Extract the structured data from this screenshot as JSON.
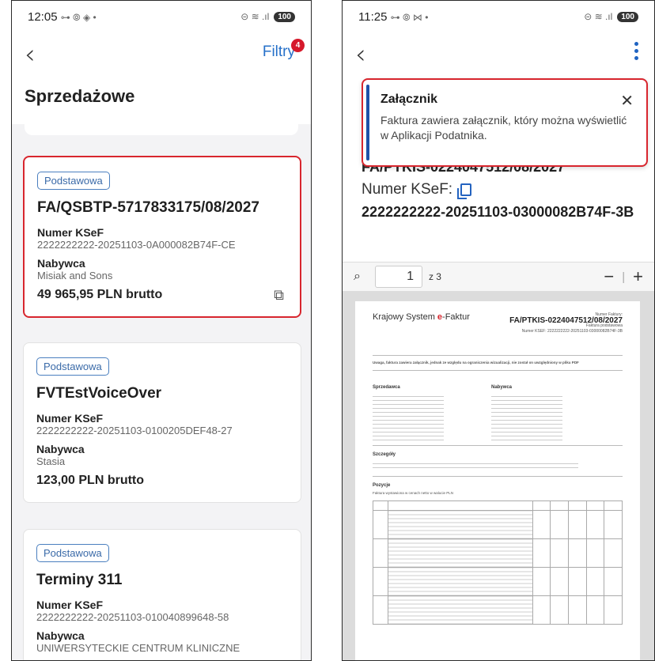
{
  "left": {
    "status": {
      "time": "12:05",
      "icons": "⊶ ⦾ ◈ •",
      "right_icons": "⊝ ≋ .ıl",
      "battery": "100"
    },
    "header": {
      "filter_label": "Filtry",
      "filter_count": "4"
    },
    "page_title": "Sprzedażowe",
    "labels": {
      "ksef": "Numer KSeF",
      "buyer": "Nabywca"
    },
    "cards": [
      {
        "tag": "Podstawowa",
        "number": "FA/QSBTP-5717833175/08/2027",
        "ksef": "2222222222-20251103-0A000082B74F-CE",
        "buyer": "Misiak and Sons",
        "amount": "49 965,95 PLN brutto",
        "attachment": true
      },
      {
        "tag": "Podstawowa",
        "number": "FVTEstVoiceOver",
        "ksef": "2222222222-20251103-0100205DEF48-27",
        "buyer": "Stasia",
        "amount": "123,00 PLN brutto"
      },
      {
        "tag": "Podstawowa",
        "number": "Terminy 311",
        "ksef": "2222222222-20251103-010040899648-58",
        "buyer": "UNIWERSYTECKIE CENTRUM KLINICZNE"
      }
    ]
  },
  "right": {
    "status": {
      "time": "11:25",
      "icons": "⊶ ⦾ ⋈ •",
      "right_icons": "⊝ ≋ .ıl",
      "battery": "100"
    },
    "toast": {
      "title": "Załącznik",
      "text": "Faktura zawiera załącznik, który można wyświetlić w Aplikacji Podatnika."
    },
    "peek_number": "FA/PTKIS-0224047512/08/2027",
    "ksef_label": "Numer KSeF:",
    "ksef_value": "2222222222-20251103-03000082B74F-3B",
    "pdf": {
      "page": "1",
      "of": "z 3",
      "logo_a": "Krajowy System ",
      "logo_b": "e",
      "logo_c": "-Faktur",
      "header_small": "Numer Faktury:",
      "invoice_no": "FA/PTKIS-0224047512/08/2027",
      "type": "Faktura podstawowa",
      "ksef_line": "Numer KSEF: 2222222222-20251103-03000082B74F-3B",
      "note": "Uwaga, faktura zawiera załącznik, jednak ze względu na ograniczenia wizualizacji, nie został on uwzględniony w pliku PDF",
      "seller": "Sprzedawca",
      "buyer": "Nabywca",
      "details": "Szczegóły",
      "items": "Pozycje",
      "items_note": "Faktura wystawiona w cenach netto w walucie PLN"
    }
  }
}
